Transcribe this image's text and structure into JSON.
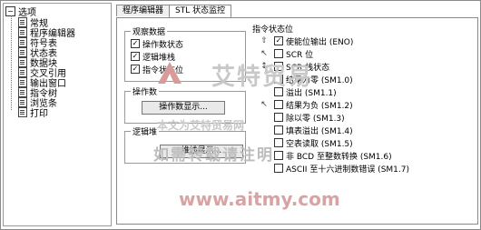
{
  "tree": {
    "root": "选项",
    "items": [
      "常规",
      "程序编辑器",
      "符号表",
      "状态表",
      "数据块",
      "交叉引用",
      "输出窗口",
      "指令树",
      "浏览条",
      "打印"
    ]
  },
  "tabs": [
    "程序编辑器",
    "STL 状态监控"
  ],
  "observe": {
    "title": "观察数据",
    "items": [
      {
        "label": "操作数状态",
        "checked": "✓"
      },
      {
        "label": "逻辑堆栈",
        "checked": "✓"
      },
      {
        "label": "指令状态位",
        "checked": "✓"
      }
    ]
  },
  "operands": {
    "title": "操作数",
    "button": "操作数显示..."
  },
  "logic": {
    "title": "逻辑堆",
    "button": "堆栈显示..."
  },
  "status": {
    "title": "指令状态位",
    "items": [
      {
        "icon": "⇧",
        "checked": "✓",
        "label": "使能位输出 (ENO)"
      },
      {
        "icon": "↖",
        "checked": "",
        "label": "SCR 位"
      },
      {
        "icon": "↕",
        "checked": "",
        "label": "SCR 栈状态"
      },
      {
        "icon": "",
        "checked": "",
        "label": "结果为零 (SM1.0)"
      },
      {
        "icon": "",
        "checked": "",
        "label": "溢出 (SM1.1)"
      },
      {
        "icon": "↖",
        "checked": "",
        "label": "结果为负 (SM1.2)"
      },
      {
        "icon": "",
        "checked": "",
        "label": "除以零 (SM1.3)"
      },
      {
        "icon": "",
        "checked": "",
        "label": "填表溢出 (SM1.4)"
      },
      {
        "icon": "",
        "checked": "",
        "label": "空表读取 (SM1.5)"
      },
      {
        "icon": "",
        "checked": "",
        "label": "非 BCD 至整数转换 (SM1.6)"
      },
      {
        "icon": "",
        "checked": "",
        "label": "ASCII 至十六进制数错误 (SM1.7)"
      }
    ]
  },
  "watermark": {
    "brand": "艾特贸易",
    "line2": "本文为艾特贸易网",
    "line3": "如需转载请注明",
    "url": "www.aitmy.com"
  }
}
